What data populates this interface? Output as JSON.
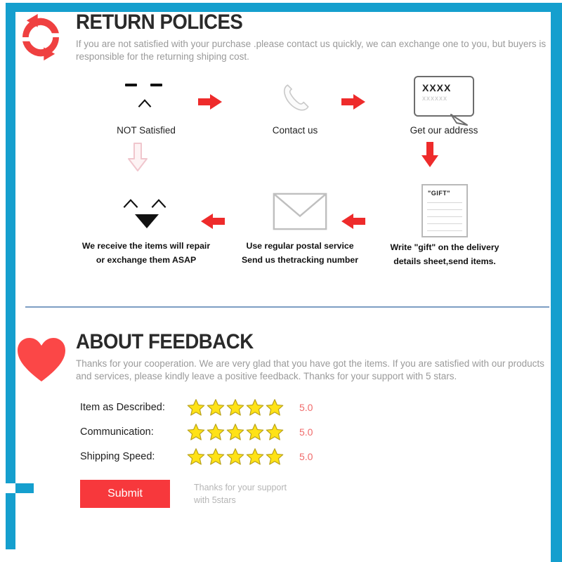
{
  "theme": {
    "frame_blue": "#159fce",
    "accent_red": "#ee2b2b",
    "submit_red": "#f7383c",
    "star_yellow": "#ffe216",
    "star_outline": "#b9a21c",
    "score_color": "#f06a6a",
    "muted_text": "#9a9a9a",
    "divider": "#7d9ec4"
  },
  "return_section": {
    "icon": "return-arrows-icon",
    "title": "RETURN POLICES",
    "subtitle": "If you are not satisfied with your purchase .please contact us quickly, we can exchange one to you, but buyers is responsible for the returning shiping cost.",
    "steps": [
      {
        "id": "not-satisfied",
        "icon": "sad-face-icon",
        "caption": "NOT Satisfied"
      },
      {
        "id": "contact-us",
        "icon": "phone-icon",
        "caption": "Contact us"
      },
      {
        "id": "get-address",
        "icon": "speech-bubble-icon",
        "caption": "Get our address",
        "bubble_line1": "XXXX",
        "bubble_line2": "xxxxxx"
      },
      {
        "id": "write-gift",
        "icon": "document-icon",
        "caption_line1": "Write \"gift\" on the delivery",
        "caption_line2": "details sheet,send items.",
        "doc_label": "\"GIFT\""
      },
      {
        "id": "postal",
        "icon": "envelope-icon",
        "caption_line1": "Use regular postal service",
        "caption_line2": "Send us thetracking number"
      },
      {
        "id": "repair",
        "icon": "happy-face-icon",
        "caption_line1": "We receive the items will repair",
        "caption_line2": "or exchange them ASAP"
      }
    ],
    "arrows": [
      {
        "id": "arrow-1",
        "direction": "right",
        "style": "solid"
      },
      {
        "id": "arrow-2",
        "direction": "right",
        "style": "solid"
      },
      {
        "id": "arrow-3",
        "direction": "down",
        "style": "solid"
      },
      {
        "id": "arrow-4",
        "direction": "left",
        "style": "solid"
      },
      {
        "id": "arrow-5",
        "direction": "left",
        "style": "solid"
      },
      {
        "id": "arrow-6",
        "direction": "down",
        "style": "ghost"
      }
    ]
  },
  "feedback_section": {
    "icon": "heart-icon",
    "title": "ABOUT FEEDBACK",
    "subtitle": "Thanks for your cooperation. We are very glad that you have got the items. If you are satisfied with our products and services, please kindly leave a positive feedback. Thanks for your support with 5 stars.",
    "ratings": [
      {
        "label": "Item as Described:",
        "stars": 5,
        "score": "5.0"
      },
      {
        "label": "Communication:",
        "stars": 5,
        "score": "5.0"
      },
      {
        "label": "Shipping Speed:",
        "stars": 5,
        "score": "5.0"
      }
    ],
    "submit_label": "Submit",
    "submit_note_line1": "Thanks for your support",
    "submit_note_line2": "with 5stars"
  }
}
